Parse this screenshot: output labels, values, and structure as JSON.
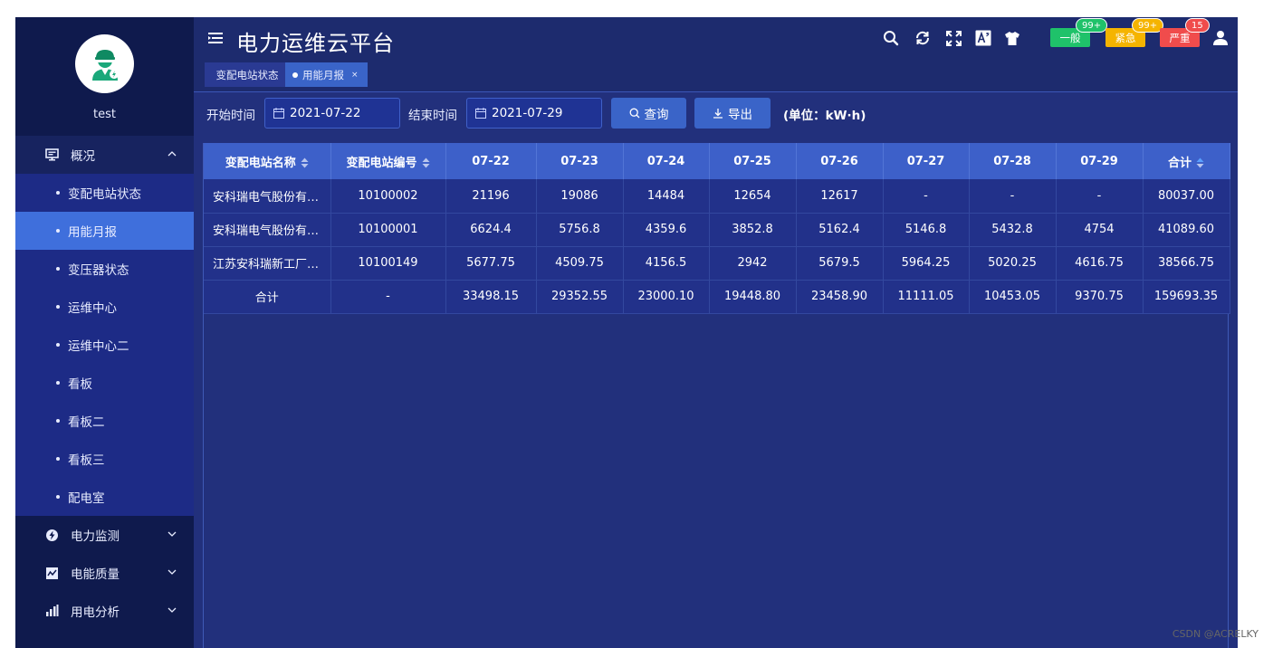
{
  "user": {
    "name": "test"
  },
  "header": {
    "title": "电力运维云平台",
    "alerts": [
      {
        "label": "一般",
        "count": "99+",
        "color": "#1fc26a"
      },
      {
        "label": "紧急",
        "count": "99+",
        "color": "#f5b400"
      },
      {
        "label": "严重",
        "count": "15",
        "color": "#f04c4c"
      }
    ]
  },
  "sidebar": {
    "groups": [
      {
        "label": "概况",
        "icon": "monitor-icon",
        "expanded": true,
        "items": [
          {
            "label": "变配电站状态"
          },
          {
            "label": "用能月报",
            "active": true
          },
          {
            "label": "变压器状态"
          },
          {
            "label": "运维中心"
          },
          {
            "label": "运维中心二"
          },
          {
            "label": "看板"
          },
          {
            "label": "看板二"
          },
          {
            "label": "看板三"
          },
          {
            "label": "配电室"
          }
        ]
      },
      {
        "label": "电力监测",
        "icon": "lightning-icon",
        "expanded": false
      },
      {
        "label": "电能质量",
        "icon": "quality-icon",
        "expanded": false
      },
      {
        "label": "用电分析",
        "icon": "bar-chart-icon",
        "expanded": false
      }
    ]
  },
  "tabs": [
    {
      "label": "变配电站状态"
    },
    {
      "label": "用能月报",
      "active": true,
      "close": "×"
    }
  ],
  "filters": {
    "start_label": "开始时间",
    "start_value": "2021-07-22",
    "end_label": "结束时间",
    "end_value": "2021-07-29",
    "query_label": "查询",
    "export_label": "导出",
    "unit": "(单位：kW·h)"
  },
  "table": {
    "headers": [
      "变配电站名称",
      "变配电站编号",
      "07-22",
      "07-23",
      "07-24",
      "07-25",
      "07-26",
      "07-27",
      "07-28",
      "07-29",
      "合计"
    ],
    "rows": [
      [
        "安科瑞电气股份有限公司",
        "10100002",
        "21196",
        "19086",
        "14484",
        "12654",
        "12617",
        "-",
        "-",
        "-",
        "80037.00"
      ],
      [
        "安科瑞电气股份有限公司",
        "10100001",
        "6624.4",
        "5756.8",
        "4359.6",
        "3852.8",
        "5162.4",
        "5146.8",
        "5432.8",
        "4754",
        "41089.60"
      ],
      [
        "江苏安科瑞新工厂配电室",
        "10100149",
        "5677.75",
        "4509.75",
        "4156.5",
        "2942",
        "5679.5",
        "5964.25",
        "5020.25",
        "4616.75",
        "38566.75"
      ],
      [
        "合计",
        "-",
        "33498.15",
        "29352.55",
        "23000.10",
        "19448.80",
        "23458.90",
        "11111.05",
        "10453.05",
        "9370.75",
        "159693.35"
      ]
    ]
  },
  "watermark": "CSDN @ACRELKY"
}
